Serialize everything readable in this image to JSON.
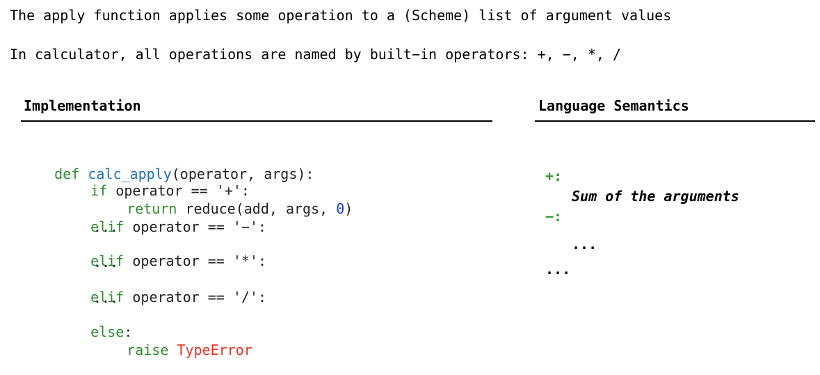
{
  "intro": {
    "line1": "The apply function applies some operation to a (Scheme) list of argument values",
    "line2": "In calculator, all operations are named by built−in operators: +, −, *, /"
  },
  "implementation": {
    "heading": "Implementation",
    "code": {
      "def_kw": "def ",
      "fn_name": "calc_apply",
      "signature": "(operator, args):",
      "if_kw": "if ",
      "if_cond": "operator == '+':",
      "return_kw": "return ",
      "return_expr_a": "reduce(add, args, ",
      "return_num": "0",
      "return_expr_b": ")",
      "elif1_kw": "elif ",
      "elif1_cond": "operator == '−':",
      "dots1": "...",
      "elif2_kw": "elif ",
      "elif2_cond": "operator == '*':",
      "dots2": "...",
      "elif3_kw": "elif ",
      "elif3_cond": "operator == '/':",
      "dots3": "...",
      "else_kw": "else",
      "else_colon": ":",
      "raise_kw": "raise ",
      "raise_err": "TypeError"
    }
  },
  "semantics": {
    "heading": "Language Semantics",
    "plus_op": "+:",
    "plus_desc": "Sum of the arguments",
    "minus_op": "−:",
    "minus_desc": "...",
    "more": "..."
  },
  "colors": {
    "keyword": "#2e8b2e",
    "function": "#1f6fb5",
    "number": "#1a40c8",
    "error": "#e8321e",
    "semantic_op": "#2e9a2e"
  }
}
